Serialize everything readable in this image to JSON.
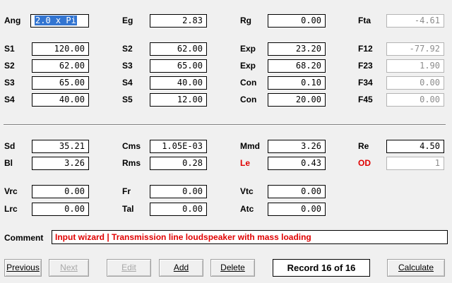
{
  "labels": {
    "ang": "Ang",
    "eg": "Eg",
    "rg": "Rg",
    "fta": "Fta",
    "s1": "S1",
    "s2a": "S2",
    "exp1": "Exp",
    "f12": "F12",
    "s2b": "S2",
    "s3a": "S3",
    "exp2": "Exp",
    "f23": "F23",
    "s3b": "S3",
    "s4a": "S4",
    "con1": "Con",
    "f34": "F34",
    "s4b": "S4",
    "s5": "S5",
    "con2": "Con",
    "f45": "F45",
    "sd": "Sd",
    "cms": "Cms",
    "mmd": "Mmd",
    "re": "Re",
    "bl": "Bl",
    "rms": "Rms",
    "le": "Le",
    "od": "OD",
    "vrc": "Vrc",
    "fr": "Fr",
    "vtc": "Vtc",
    "lrc": "Lrc",
    "tal": "Tal",
    "atc": "Atc",
    "comment": "Comment"
  },
  "values": {
    "ang": "2.0 x Pi",
    "eg": "2.83",
    "rg": "0.00",
    "fta": "-4.61",
    "s1": "120.00",
    "s2a": "62.00",
    "exp1": "23.20",
    "f12": "-77.92",
    "s2b": "62.00",
    "s3a": "65.00",
    "exp2": "68.20",
    "f23": "1.90",
    "s3b": "65.00",
    "s4a": "40.00",
    "con1": "0.10",
    "f34": "0.00",
    "s4b": "40.00",
    "s5": "12.00",
    "con2": "20.00",
    "f45": "0.00",
    "sd": "35.21",
    "cms": "1.05E-03",
    "mmd": "3.26",
    "re": "4.50",
    "bl": "3.26",
    "rms": "0.28",
    "le": "0.43",
    "od": "1",
    "vrc": "0.00",
    "fr": "0.00",
    "vtc": "0.00",
    "lrc": "0.00",
    "tal": "0.00",
    "atc": "0.00"
  },
  "comment_text": "Input wizard | Transmission line loudspeaker with mass loading",
  "buttons": {
    "previous": "Previous",
    "next": "Next",
    "edit": "Edit",
    "add": "Add",
    "delete": "Delete",
    "calculate": "Calculate"
  },
  "record_status": "Record 16 of 16",
  "colors": {
    "selection": "#3375d1",
    "red_label": "#e00000",
    "readonly_text": "#8c8c8c"
  }
}
